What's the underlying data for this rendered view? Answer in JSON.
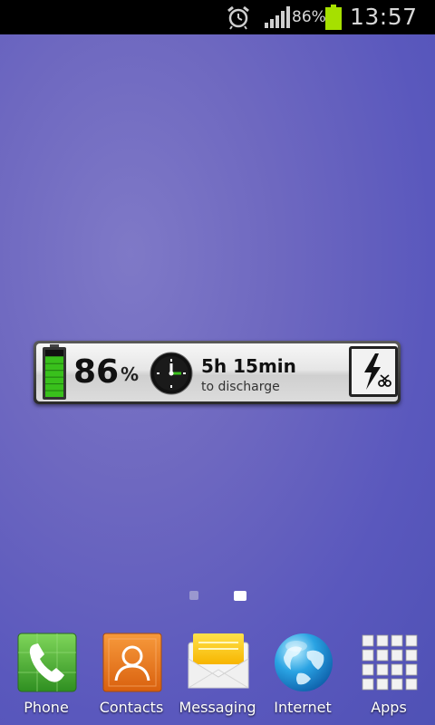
{
  "status_bar": {
    "battery_percent": "86%",
    "time": "13:57",
    "icons": [
      "alarm-icon",
      "signal-icon",
      "battery-icon"
    ]
  },
  "widget": {
    "battery_value": "86",
    "percent_sign": "%",
    "time_remaining": "5h 15min",
    "time_caption": "to discharge",
    "battery_level": 0.86,
    "accent": "#39c01c"
  },
  "pager": {
    "pages": 2,
    "current": 2
  },
  "dock": {
    "items": [
      {
        "label": "Phone",
        "icon": "phone-icon"
      },
      {
        "label": "Contacts",
        "icon": "contacts-icon"
      },
      {
        "label": "Messaging",
        "icon": "messaging-icon"
      },
      {
        "label": "Internet",
        "icon": "internet-icon"
      },
      {
        "label": "Apps",
        "icon": "apps-grid-icon"
      }
    ]
  }
}
